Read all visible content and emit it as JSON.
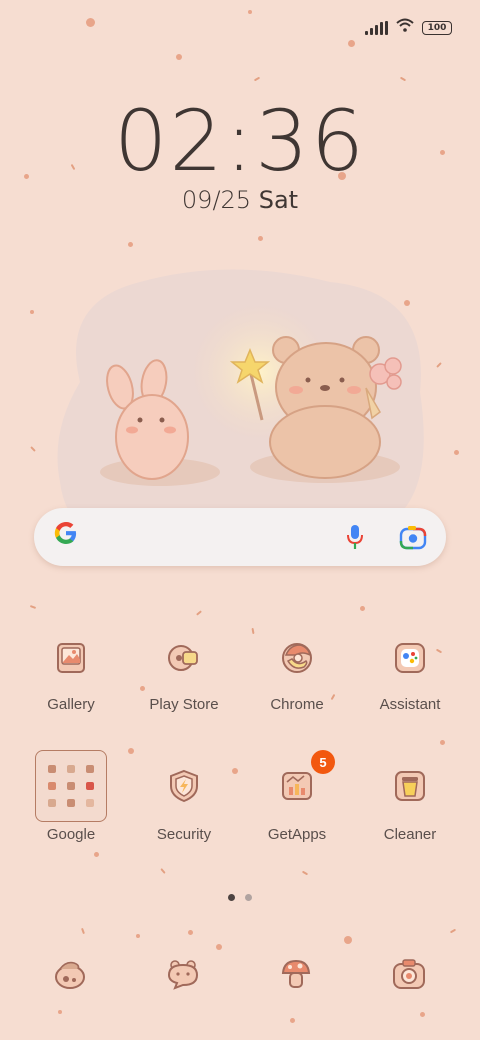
{
  "status_bar": {
    "battery": "100"
  },
  "clock": {
    "time": "02:36",
    "date_numeric": "09/25",
    "day": "Sat"
  },
  "search_bar": {
    "logo": "G",
    "icons": [
      "microphone-icon",
      "lens-camera-icon"
    ]
  },
  "apps_row1": [
    {
      "label": "Gallery",
      "icon": "gallery-icon"
    },
    {
      "label": "Play Store",
      "icon": "play-store-icon"
    },
    {
      "label": "Chrome",
      "icon": "chrome-icon"
    },
    {
      "label": "Assistant",
      "icon": "assistant-icon"
    }
  ],
  "apps_row2": [
    {
      "label": "Google",
      "icon": "google-folder"
    },
    {
      "label": "Security",
      "icon": "security-shield-icon"
    },
    {
      "label": "GetApps",
      "icon": "getapps-icon",
      "badge": "5"
    },
    {
      "label": "Cleaner",
      "icon": "cleaner-icon"
    }
  ],
  "pager": {
    "pages": 2,
    "current": 1
  },
  "dock": [
    "phone-icon",
    "messages-icon",
    "browser-icon",
    "camera-icon"
  ],
  "colors": {
    "background": "#f6ddd1",
    "accent": "#f2580f",
    "icon_stroke": "#a0695a"
  }
}
